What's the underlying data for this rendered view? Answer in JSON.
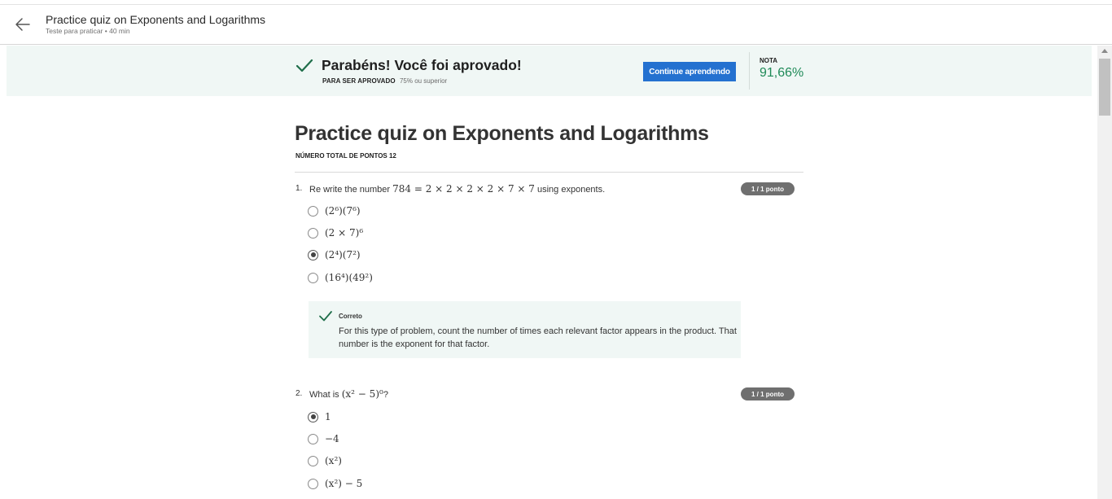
{
  "header": {
    "title": "Practice quiz on Exponents and Logarithms",
    "subtitle": "Teste para praticar • 40 min"
  },
  "banner": {
    "title": "Parabéns! Você foi aprovado!",
    "pass_label": "PARA SER APROVADO",
    "pass_value": "75% ou superior",
    "continue_button": "Continue aprendendo",
    "grade_label": "NOTA",
    "grade_value": "91,66%",
    "accent_color": "#2471d0",
    "success_color": "#1f8a58"
  },
  "quiz": {
    "title": "Practice quiz on Exponents and Logarithms",
    "total_points": "NÚMERO TOTAL DE PONTOS 12",
    "questions": [
      {
        "number": "1.",
        "text_before": "Re write the number ",
        "math": "784 = 2 × 2 × 2 × 2 × 7 × 7",
        "text_after": " using exponents.",
        "points": "1 / 1 ponto",
        "options": [
          "(2⁶)(7⁶)",
          "(2 × 7)⁶",
          "(2⁴)(7²)",
          "(16⁴)(49²)"
        ],
        "selected_index": 2,
        "feedback": {
          "title": "Correto",
          "text": "For this type of problem, count the number of times each relevant factor appears in the product. That number is the exponent for that factor."
        }
      },
      {
        "number": "2.",
        "text_before": "What is ",
        "math": "(x² − 5)⁰",
        "text_after": "?",
        "points": "1 / 1 ponto",
        "options": [
          "1",
          "−4",
          "(x²)",
          "(x²) − 5"
        ],
        "selected_index": 0
      }
    ]
  },
  "icons": {
    "back": "arrow-left-icon",
    "check": "checkmark-icon"
  }
}
